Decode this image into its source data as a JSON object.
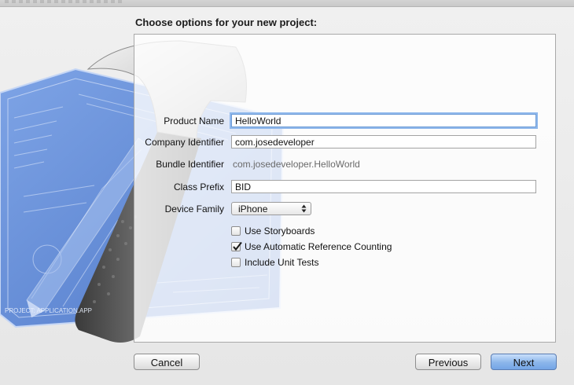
{
  "dialog": {
    "heading": "Choose options for your new project:",
    "fields": {
      "product_name": {
        "label": "Product Name",
        "value": "HelloWorld"
      },
      "company_identifier": {
        "label": "Company Identifier",
        "value": "com.josedeveloper"
      },
      "bundle_identifier": {
        "label": "Bundle Identifier",
        "value": "com.josedeveloper.HelloWorld"
      },
      "class_prefix": {
        "label": "Class Prefix",
        "value": "BID"
      },
      "device_family": {
        "label": "Device Family",
        "value": "iPhone"
      }
    },
    "checkboxes": [
      {
        "label": "Use Storyboards",
        "checked": false
      },
      {
        "label": "Use Automatic Reference Counting",
        "checked": true
      },
      {
        "label": "Include Unit Tests",
        "checked": false
      }
    ],
    "buttons": {
      "cancel": "Cancel",
      "previous": "Previous",
      "next": "Next"
    },
    "accent_color": "#6d9bd6"
  },
  "blueprint": {
    "caption": "PROJECT: APPLICATION.APP"
  }
}
